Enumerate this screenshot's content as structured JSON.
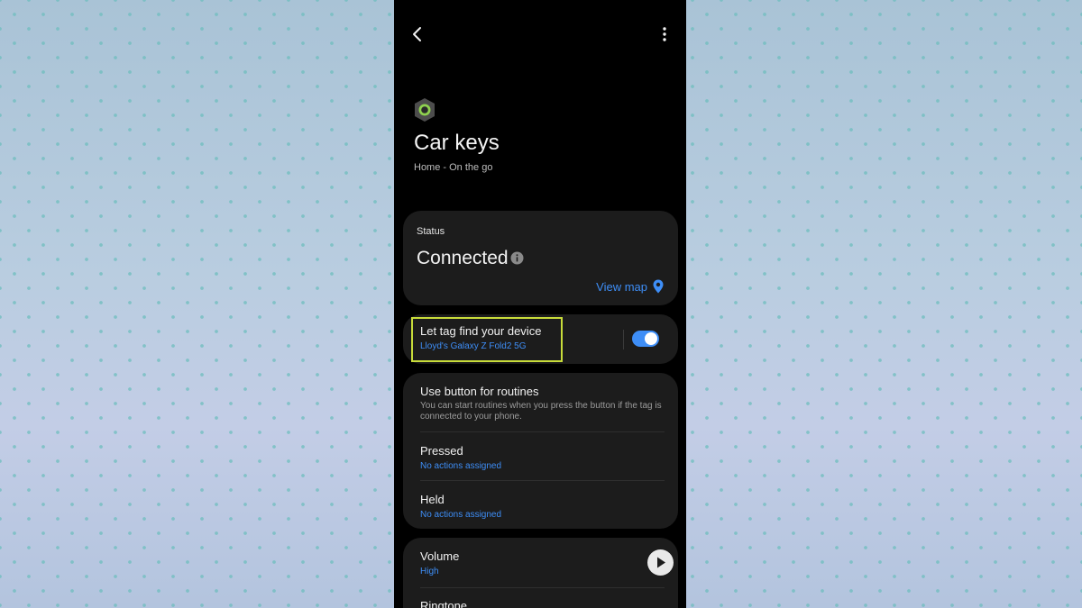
{
  "header": {
    "title": "Car keys",
    "subtitle": "Home - On the go",
    "icons": {
      "back": "chevron-left-icon",
      "more": "more-vertical-icon",
      "tag": "smarttag-icon"
    }
  },
  "status": {
    "label": "Status",
    "value": "Connected",
    "info_icon": "info-icon",
    "view_map_label": "View map",
    "map_icon": "map-pin-icon"
  },
  "tag_find": {
    "title": "Let tag find your device",
    "device": "Lloyd's Galaxy Z Fold2 5G",
    "enabled": true,
    "highlight_color": "#c8dc3a"
  },
  "routines": {
    "title": "Use button for routines",
    "description": "You can start routines when you press the button if the tag is connected to your phone.",
    "pressed": {
      "label": "Pressed",
      "value": "No actions assigned"
    },
    "held": {
      "label": "Held",
      "value": "No actions assigned"
    }
  },
  "volume": {
    "label": "Volume",
    "value": "High",
    "play_icon": "play-icon"
  },
  "ringtone": {
    "label": "Ringtone"
  },
  "colors": {
    "accent": "#3e8ef7",
    "card": "#1c1c1c",
    "background": "#000000",
    "tag_ring": "#8fd14f"
  }
}
